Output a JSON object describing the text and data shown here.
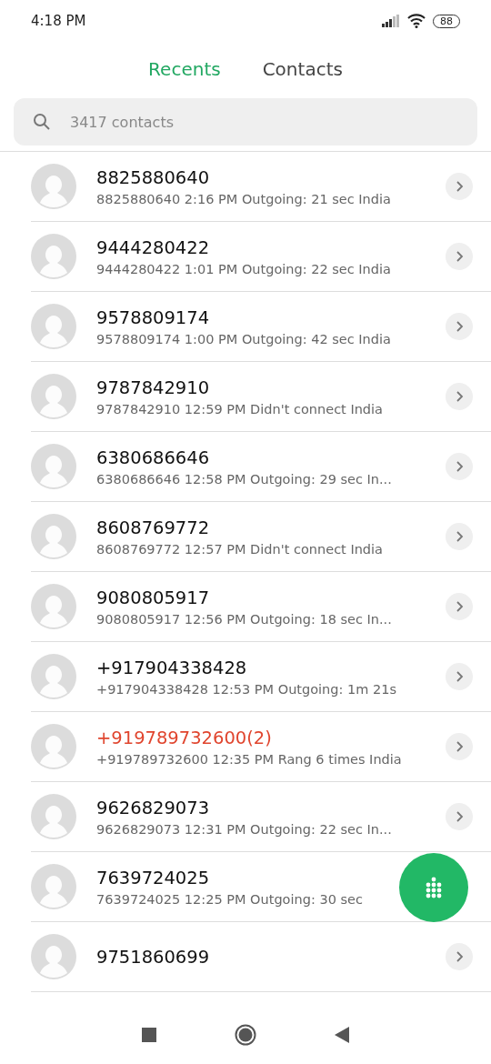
{
  "status_bar": {
    "time": "4:18 PM",
    "battery": "88"
  },
  "tabs": [
    {
      "label": "Recents",
      "selected": true
    },
    {
      "label": "Contacts",
      "selected": false
    }
  ],
  "search": {
    "placeholder": "3417 contacts"
  },
  "calls": [
    {
      "name": "8825880640",
      "detail": "8825880640  2:16 PM Outgoing: 21 sec  India",
      "missed": false,
      "chevron": true
    },
    {
      "name": "9444280422",
      "detail": "9444280422  1:01 PM Outgoing: 22 sec  India",
      "missed": false,
      "chevron": true
    },
    {
      "name": "9578809174",
      "detail": "9578809174  1:00 PM Outgoing: 42 sec  India",
      "missed": false,
      "chevron": true
    },
    {
      "name": "9787842910",
      "detail": "9787842910  12:59 PM Didn't connect  India",
      "missed": false,
      "chevron": true
    },
    {
      "name": "6380686646",
      "detail": "6380686646  12:58 PM Outgoing: 29 sec  In...",
      "missed": false,
      "chevron": true
    },
    {
      "name": "8608769772",
      "detail": "8608769772  12:57 PM Didn't connect  India",
      "missed": false,
      "chevron": true
    },
    {
      "name": "9080805917",
      "detail": "9080805917  12:56 PM Outgoing: 18 sec  In...",
      "missed": false,
      "chevron": true
    },
    {
      "name": "+917904338428",
      "detail": "+917904338428  12:53 PM Outgoing: 1m 21s",
      "missed": false,
      "chevron": true
    },
    {
      "name": "+919789732600(2)",
      "detail": "+919789732600  12:35 PM Rang 6 times  India",
      "missed": true,
      "chevron": true
    },
    {
      "name": "9626829073",
      "detail": "9626829073  12:31 PM Outgoing: 22 sec  In...",
      "missed": false,
      "chevron": true
    },
    {
      "name": "7639724025",
      "detail": "7639724025  12:25 PM Outgoing: 30 sec",
      "missed": false,
      "chevron": false
    },
    {
      "name": "9751860699",
      "missed": false,
      "chevron": true
    }
  ]
}
